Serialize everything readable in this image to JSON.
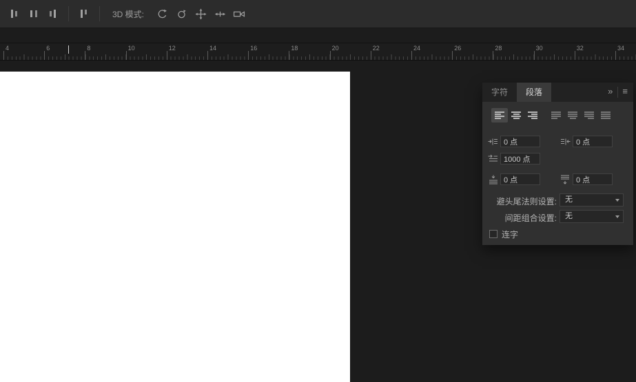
{
  "options_bar": {
    "mode_label": "3D 模式:",
    "left_icons": [
      "align-left-edges",
      "align-centers",
      "align-right-edges",
      "distribute-bars"
    ],
    "mode_icons": [
      "orbit-3d-camera",
      "roll-3d-camera",
      "pan-3d-camera",
      "slide-3d-camera",
      "zoom-3d-camera"
    ]
  },
  "ruler": {
    "labels": [
      "4",
      "6",
      "8",
      "10",
      "12",
      "14",
      "16",
      "18",
      "20",
      "22",
      "24",
      "26",
      "28",
      "30",
      "32",
      "34"
    ]
  },
  "panel": {
    "tabs": [
      {
        "label": "字符",
        "active": false
      },
      {
        "label": "段落",
        "active": true
      }
    ],
    "collapse_icon": "»",
    "menu_icon": "≡",
    "align_buttons": [
      {
        "name": "align-left",
        "selected": true,
        "enabled": true
      },
      {
        "name": "align-center",
        "selected": false,
        "enabled": true
      },
      {
        "name": "align-right",
        "selected": false,
        "enabled": true
      },
      {
        "name": "justify-last-left",
        "selected": false,
        "enabled": false
      },
      {
        "name": "justify-last-center",
        "selected": false,
        "enabled": false
      },
      {
        "name": "justify-last-right",
        "selected": false,
        "enabled": false
      },
      {
        "name": "justify-all",
        "selected": false,
        "enabled": false
      }
    ],
    "fields": {
      "indent_left": "0 点",
      "indent_right": "0 点",
      "first_line_indent": "1000 点",
      "space_before": "0 点",
      "space_after": "0 点"
    },
    "kinsoku": {
      "label": "避头尾法则设置:",
      "value": "无"
    },
    "mojikumi": {
      "label": "间距组合设置:",
      "value": "无"
    },
    "hyphenate": {
      "label": "连字",
      "checked": false
    }
  },
  "ui_colors": {
    "canvas": "#ffffff",
    "workspace_background": "#1c1c1c",
    "panel_background": "#303030",
    "options_bar_background": "#2c2c2c"
  }
}
